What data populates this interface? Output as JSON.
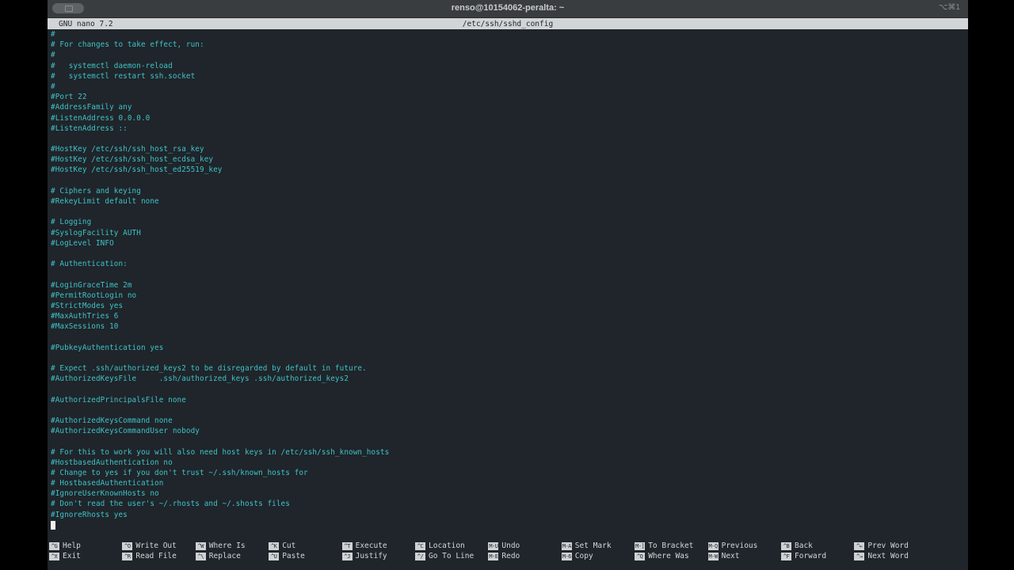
{
  "window": {
    "title": "renso@10154062-peralta: ~",
    "shortcut": "⌥⌘1"
  },
  "nano": {
    "version": "GNU nano 7.2",
    "filename": "/etc/ssh/sshd_config"
  },
  "lines": [
    "#",
    "# For changes to take effect, run:",
    "#",
    "#   systemctl daemon-reload",
    "#   systemctl restart ssh.socket",
    "#",
    "#Port 22",
    "#AddressFamily any",
    "#ListenAddress 0.0.0.0",
    "#ListenAddress ::",
    "",
    "#HostKey /etc/ssh/ssh_host_rsa_key",
    "#HostKey /etc/ssh/ssh_host_ecdsa_key",
    "#HostKey /etc/ssh/ssh_host_ed25519_key",
    "",
    "# Ciphers and keying",
    "#RekeyLimit default none",
    "",
    "# Logging",
    "#SyslogFacility AUTH",
    "#LogLevel INFO",
    "",
    "# Authentication:",
    "",
    "#LoginGraceTime 2m",
    "#PermitRootLogin no",
    "#StrictModes yes",
    "#MaxAuthTries 6",
    "#MaxSessions 10",
    "",
    "#PubkeyAuthentication yes",
    "",
    "# Expect .ssh/authorized_keys2 to be disregarded by default in future.",
    "#AuthorizedKeysFile     .ssh/authorized_keys .ssh/authorized_keys2",
    "",
    "#AuthorizedPrincipalsFile none",
    "",
    "#AuthorizedKeysCommand none",
    "#AuthorizedKeysCommandUser nobody",
    "",
    "# For this to work you will also need host keys in /etc/ssh/ssh_known_hosts",
    "#HostbasedAuthentication no",
    "# Change to yes if you don't trust ~/.ssh/known_hosts for",
    "# HostbasedAuthentication",
    "#IgnoreUserKnownHosts no",
    "# Don't read the user's ~/.rhosts and ~/.shosts files",
    "#IgnoreRhosts yes"
  ],
  "shortcuts": [
    {
      "k1": "^G",
      "l1": "Help",
      "k2": "^X",
      "l2": "Exit"
    },
    {
      "k1": "^O",
      "l1": "Write Out",
      "k2": "^R",
      "l2": "Read File"
    },
    {
      "k1": "^W",
      "l1": "Where Is",
      "k2": "^\\",
      "l2": "Replace"
    },
    {
      "k1": "^K",
      "l1": "Cut",
      "k2": "^U",
      "l2": "Paste"
    },
    {
      "k1": "^T",
      "l1": "Execute",
      "k2": "^J",
      "l2": "Justify"
    },
    {
      "k1": "^C",
      "l1": "Location",
      "k2": "^/",
      "l2": "Go To Line"
    },
    {
      "k1": "M-U",
      "l1": "Undo",
      "k2": "M-E",
      "l2": "Redo"
    },
    {
      "k1": "M-A",
      "l1": "Set Mark",
      "k2": "M-6",
      "l2": "Copy"
    },
    {
      "k1": "M-]",
      "l1": "To Bracket",
      "k2": "^Q",
      "l2": "Where Was"
    },
    {
      "k1": "M-Q",
      "l1": "Previous",
      "k2": "M-W",
      "l2": "Next"
    },
    {
      "k1": "^B",
      "l1": "Back",
      "k2": "^F",
      "l2": "Forward"
    },
    {
      "k1": "^←",
      "l1": "Prev Word",
      "k2": "^→",
      "l2": "Next Word"
    }
  ],
  "colors": {
    "editor_bg": "#1f252a",
    "text": "#3fc2c8",
    "header_bg": "#d2d5d8"
  }
}
